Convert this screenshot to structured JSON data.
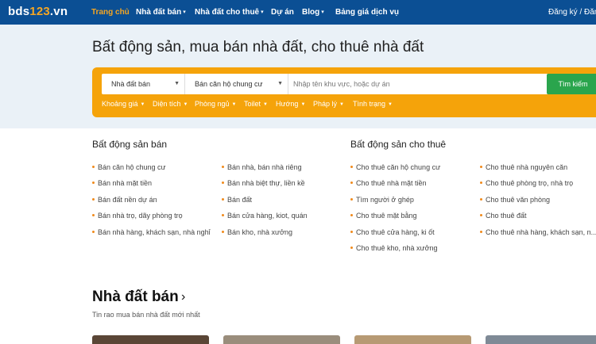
{
  "logo": {
    "prefix": "bds",
    "number": "123",
    "suffix": ".vn"
  },
  "nav": {
    "items": [
      {
        "label": "Trang chủ",
        "active": true,
        "dropdown": false
      },
      {
        "label": "Nhà đất bán",
        "active": false,
        "dropdown": true
      },
      {
        "label": "Nhà đất cho thuê",
        "active": false,
        "dropdown": true
      },
      {
        "label": "Dự án",
        "active": false,
        "dropdown": false
      },
      {
        "label": "Blog",
        "active": false,
        "dropdown": true
      },
      {
        "label": "Bảng giá dịch vụ",
        "active": false,
        "dropdown": false
      }
    ],
    "auth_label": "Đăng ký / Đăng"
  },
  "hero": {
    "title": "Bất động sản, mua bán nhà đất, cho thuê nhà đất",
    "search": {
      "type_value": "Nhà đất bán",
      "category_value": "Bán căn hộ chung cư",
      "keyword_placeholder": "Nhập tên khu vực, hoặc dự án",
      "button_label": "Tìm kiếm"
    },
    "filters": [
      "Khoảng giá",
      "Diện tích",
      "Phòng ngủ",
      "Toilet",
      "Hướng",
      "Pháp lý",
      "Tình trạng"
    ]
  },
  "sale": {
    "title": "Bất động sản bán",
    "col1": [
      "Bán căn hộ chung cư",
      "Bán nhà mặt tiền",
      "Bán đất nền dự án",
      "Bán nhà trọ, dãy phòng trọ",
      "Bán nhà hàng, khách sạn, nhà nghỉ"
    ],
    "col2": [
      "Bán nhà, bán nhà riêng",
      "Bán nhà biệt thự, liền kề",
      "Bán đất",
      "Bán cửa hàng, kiot, quán",
      "Bán kho, nhà xưởng"
    ]
  },
  "rent": {
    "title": "Bất động sản cho thuê",
    "col1": [
      "Cho thuê căn hộ chung cư",
      "Cho thuê nhà mặt tiền",
      "Tìm người ở ghép",
      "Cho thuê mặt bằng",
      "Cho thuê cửa hàng, ki ốt",
      "Cho thuê kho, nhà xưởng"
    ],
    "col2": [
      "Cho thuê nhà nguyên căn",
      "Cho thuê phòng trọ, nhà trọ",
      "Cho thuê văn phòng",
      "Cho thuê đất",
      "Cho thuê nhà hàng, khách sạn, n..."
    ]
  },
  "listing_section": {
    "title": "Nhà đất bán",
    "subtitle": "Tin rao mua bán nhà đất mới nhất"
  },
  "colors": {
    "nav_bg": "#0b4f94",
    "accent": "#f5a30a",
    "button_green": "#2aa54d",
    "bullet": "#f08a1c"
  },
  "icons": {
    "caret": "chevron-down-icon",
    "section_arrow": "chevron-right-icon"
  }
}
